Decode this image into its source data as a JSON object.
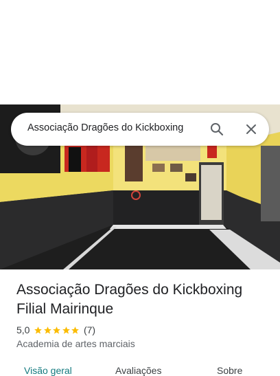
{
  "search": {
    "query": "Associação Dragões do Kickboxing",
    "search_icon": "search-icon",
    "close_icon": "close-icon"
  },
  "place": {
    "title": "Associação Dragões do Kickboxing Filial Mairinque",
    "rating": "5,0",
    "stars": 5,
    "review_count": "(7)",
    "category": "Academia de artes marciais"
  },
  "tabs": [
    {
      "label": "Visão geral",
      "active": true
    },
    {
      "label": "Avaliações",
      "active": false
    },
    {
      "label": "Sobre",
      "active": false
    }
  ],
  "colors": {
    "star": "#fbbc04",
    "active_tab": "#137a7f",
    "wall": "#f4e27a",
    "floor": "#1e1e1e"
  }
}
